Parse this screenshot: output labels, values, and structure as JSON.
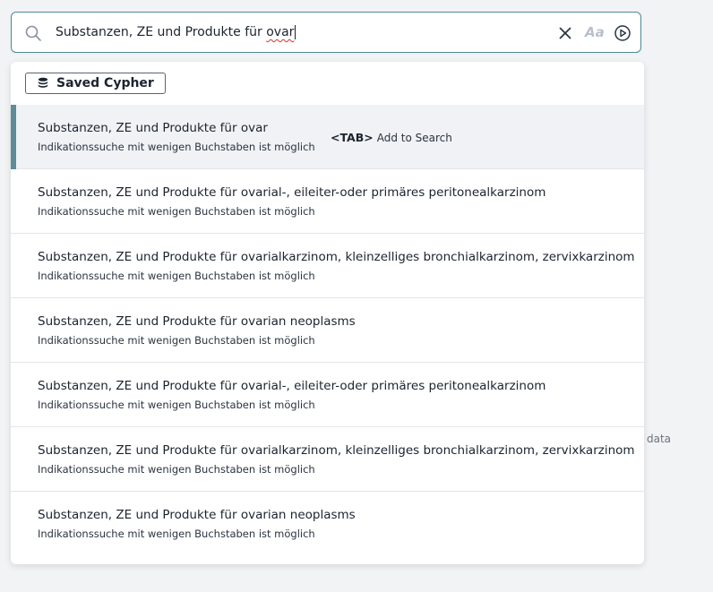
{
  "background": {
    "right_text": "data"
  },
  "search": {
    "query_prefix": "Substanzen, ZE und Produkte für ",
    "query_typed": "ovar",
    "clear_icon": "close-icon",
    "case_toggle_label": "Aa",
    "run_icon": "play-circle-icon"
  },
  "dropdown": {
    "saved_cypher_label": "Saved Cypher",
    "saved_cypher_icon": "database-icon",
    "tab_hint": {
      "key": "<TAB>",
      "label": "Add to Search"
    },
    "suggestions": [
      {
        "title": "Substanzen, ZE und Produkte für ovar",
        "subtitle": "Indikationssuche mit wenigen Buchstaben ist möglich",
        "active": true
      },
      {
        "title": "Substanzen, ZE und Produkte für ovarial-, eileiter-oder primäres peritonealkarzinom",
        "subtitle": "Indikationssuche mit wenigen Buchstaben ist möglich"
      },
      {
        "title": "Substanzen, ZE und Produkte für ovarialkarzinom, kleinzelliges bronchialkarzinom, zervixkarzinom",
        "subtitle": "Indikationssuche mit wenigen Buchstaben ist möglich"
      },
      {
        "title": "Substanzen, ZE und Produkte für ovarian neoplasms",
        "subtitle": "Indikationssuche mit wenigen Buchstaben ist möglich"
      },
      {
        "title": "Substanzen, ZE und Produkte für ovarial-, eileiter-oder primäres peritonealkarzinom",
        "subtitle": "Indikationssuche mit wenigen Buchstaben ist möglich"
      },
      {
        "title": "Substanzen, ZE und Produkte für ovarialkarzinom, kleinzelliges bronchialkarzinom, zervixkarzinom",
        "subtitle": "Indikationssuche mit wenigen Buchstaben ist möglich"
      },
      {
        "title": "Substanzen, ZE und Produkte für ovarian neoplasms",
        "subtitle": "Indikationssuche mit wenigen Buchstaben ist möglich"
      }
    ]
  },
  "colors": {
    "accent": "#5e8c98",
    "input_border": "#4f8a96",
    "active_row_bg": "#f0f2f5",
    "spellcheck_underline": "#d6342c"
  }
}
